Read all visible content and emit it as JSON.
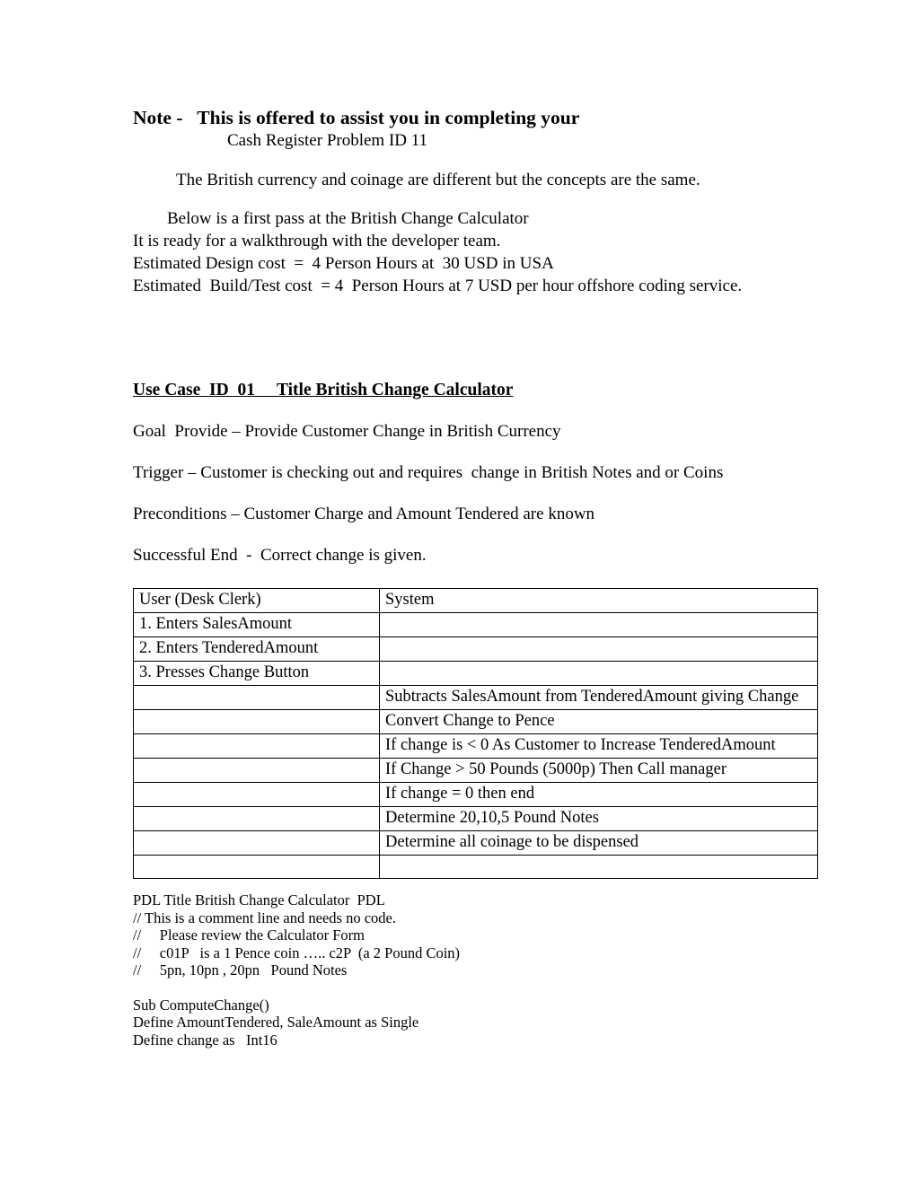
{
  "document": {
    "heading": {
      "note_label": "Note -",
      "note_text": "This is offered to assist you in completing your",
      "subtitle": "Cash Register Problem ID 11"
    },
    "intro": {
      "currency_note": "The British currency and coinage are different but the concepts are the same.",
      "lines": [
        "Below is a first pass at the British Change Calculator",
        "It is ready for a walkthrough with the developer team.",
        "Estimated Design cost  =  4 Person Hours at  30 USD in USA",
        "Estimated  Build/Test cost  = 4  Person Hours at 7 USD per hour offshore coding service."
      ]
    },
    "use_case": {
      "title": "Use Case  ID  01     Title British Change Calculator",
      "goal": "Goal  Provide – Provide Customer Change in British Currency",
      "trigger": "Trigger – Customer is checking out and requires  change in British Notes and or Coins",
      "preconditions": "Preconditions – Customer Charge and Amount Tendered are known",
      "successful_end": "Successful End  -  Correct change is given."
    },
    "table": {
      "headers": {
        "user": "User (Desk Clerk)",
        "system": "System"
      },
      "rows": [
        {
          "user": "1. Enters SalesAmount",
          "system": ""
        },
        {
          "user": "2. Enters TenderedAmount",
          "system": ""
        },
        {
          "user": "3. Presses Change Button",
          "system": ""
        },
        {
          "user": "",
          "system": "Subtracts SalesAmount from TenderedAmount giving Change"
        },
        {
          "user": "",
          "system": "Convert Change to Pence"
        },
        {
          "user": "",
          "system": "If change is  < 0  As Customer to Increase TenderedAmount"
        },
        {
          "user": "",
          "system": "If Change > 50 Pounds (5000p) Then Call manager"
        },
        {
          "user": "",
          "system": "If change = 0 then end"
        },
        {
          "user": "",
          "system": "Determine 20,10,5 Pound Notes"
        },
        {
          "user": "",
          "system": "Determine all coinage to be dispensed"
        },
        {
          "user": "",
          "system": ""
        }
      ]
    },
    "pdl": {
      "lines": [
        "PDL Title British Change Calculator  PDL",
        "// This is a comment line and needs no code.",
        "//     Please review the Calculator Form",
        "//     c01P   is a 1 Pence coin ….. c2P  (a 2 Pound Coin)",
        "//     5pn, 10pn , 20pn   Pound Notes"
      ],
      "code_lines": [
        "Sub ComputeChange()",
        "Define AmountTendered, SaleAmount as Single",
        "Define change as   Int16"
      ]
    }
  }
}
